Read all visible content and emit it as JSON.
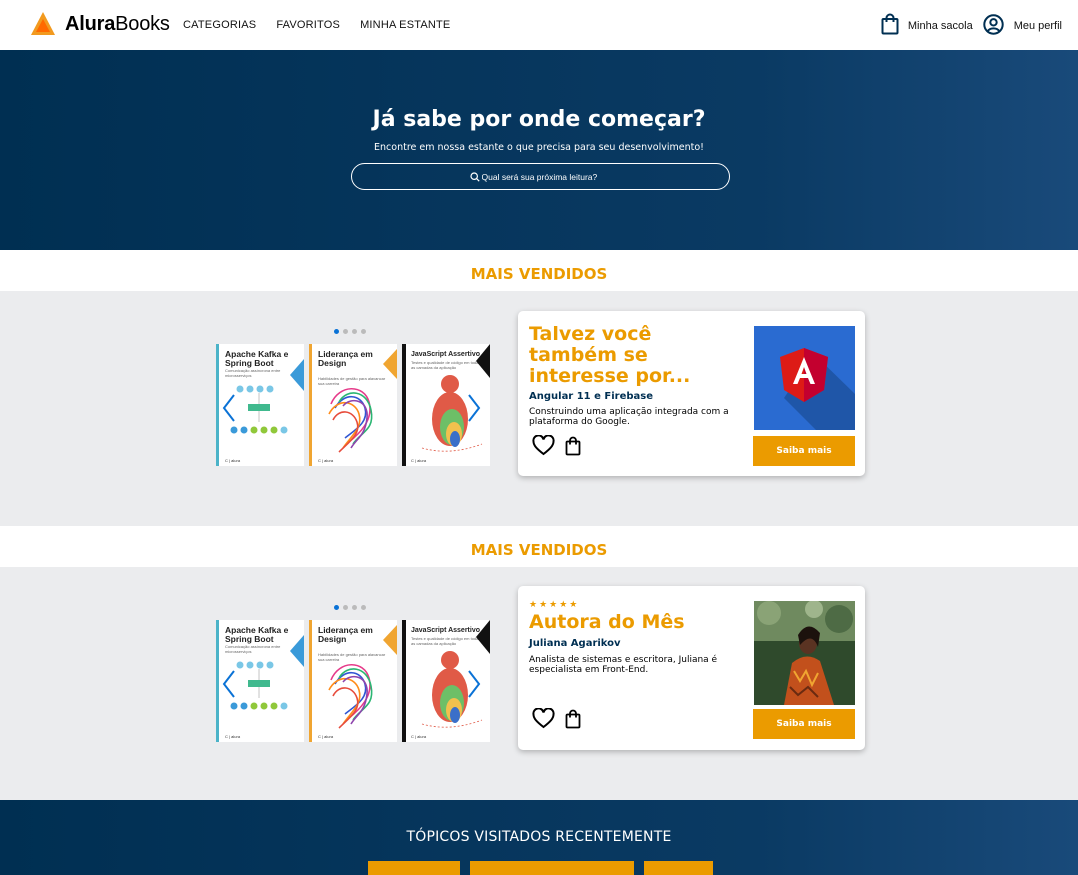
{
  "header": {
    "logo_bold": "Alura",
    "logo_light": "Books",
    "nav": [
      "CATEGORIAS",
      "FAVORITOS",
      "MINHA ESTANTE"
    ],
    "bag_label": "Minha sacola",
    "profile_label": "Meu perfil"
  },
  "hero": {
    "title": "Já sabe por onde começar?",
    "subtitle": "Encontre em nossa estante o que precisa para seu desenvolvimento!",
    "search_placeholder": "Qual será sua próxima leitura?"
  },
  "sections": [
    {
      "title": "MAIS VENDIDOS",
      "card": {
        "heading": "Talvez você também se interesse por...",
        "name": "Angular 11 e Firebase",
        "description": "Construindo uma aplicação integrada com a plataforma do Google.",
        "button": "Saiba mais"
      }
    },
    {
      "title": "MAIS VENDIDOS",
      "card": {
        "stars": "★★★★★",
        "heading": "Autora do Mês",
        "name": "Juliana Agarikov",
        "description": "Analista de sistemas e escritora, Juliana é especialista em Front-End.",
        "button": "Saiba mais"
      }
    }
  ],
  "books": [
    {
      "title": "Apache Kafka e Spring Boot",
      "subtitle": "Comunicação assíncrona entre microsserviços",
      "accent": "#3a9ad9"
    },
    {
      "title": "Liderança em Design",
      "subtitle": "Habilidades de gestão para alavancar sua carreira",
      "accent": "#f0a531"
    },
    {
      "title": "JavaScript Assertivo",
      "subtitle": "Testes e qualidade de código em todas as camadas da aplicação",
      "accent": "#111111"
    }
  ],
  "topics": {
    "title": "TÓPICOS VISITADOS RECENTEMENTE"
  },
  "colors": {
    "brand_navy": "#002f52",
    "accent_orange": "#eb9b00",
    "band_gray": "#ebecee",
    "carousel_blue": "#0a72d6"
  }
}
